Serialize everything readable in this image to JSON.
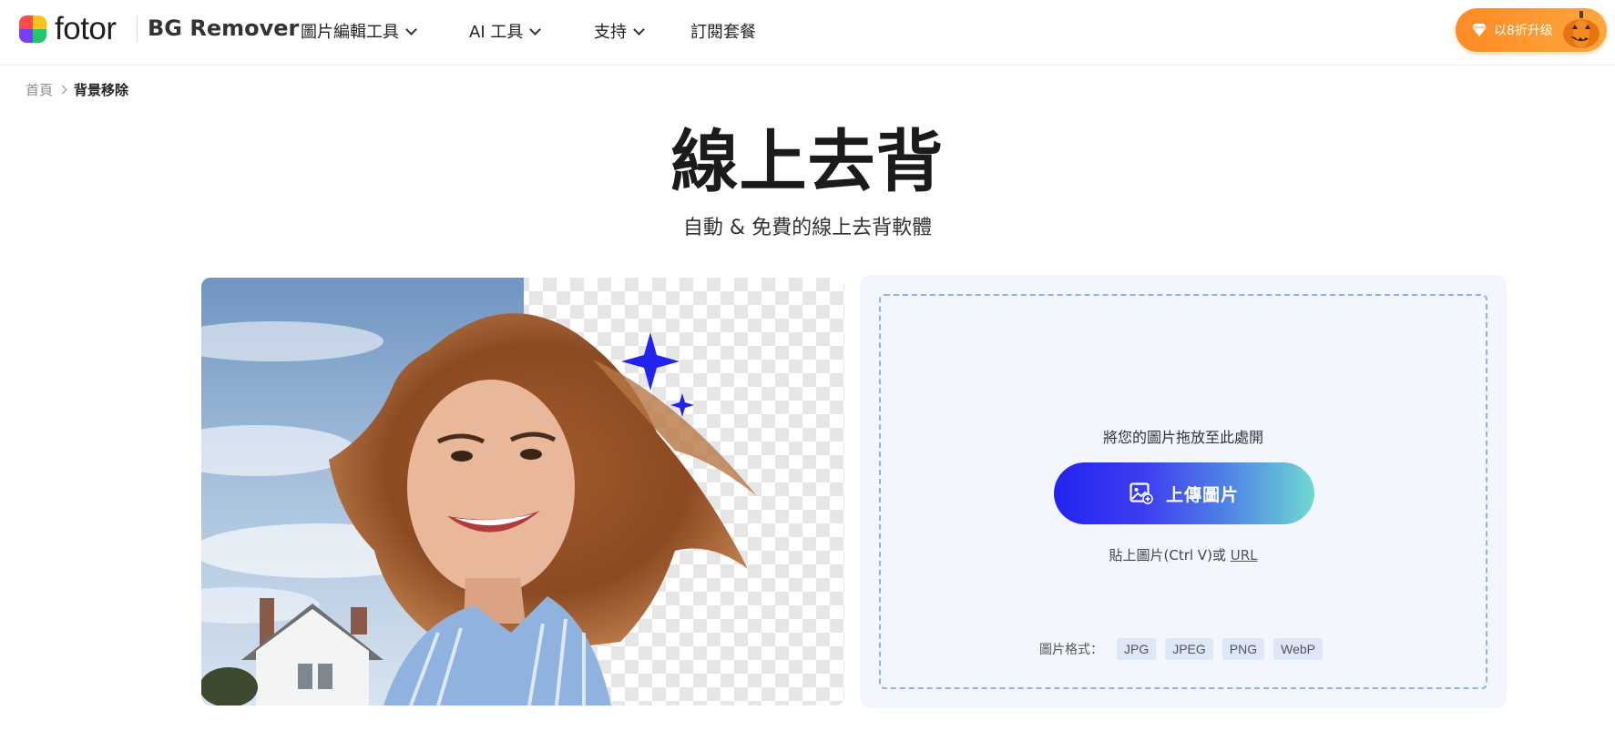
{
  "header": {
    "logo_text": "fotor",
    "product_name": "BG Remover",
    "nav": [
      {
        "label": "圖片編輯工具",
        "has_dropdown": true
      },
      {
        "label": "AI 工具",
        "has_dropdown": true
      },
      {
        "label": "支持",
        "has_dropdown": true
      },
      {
        "label": "訂閱套餐",
        "has_dropdown": false
      }
    ],
    "upgrade_label": "以8折升级"
  },
  "breadcrumb": {
    "home": "首頁",
    "current": "背景移除"
  },
  "hero": {
    "title": "線上去背",
    "subtitle": "自動 & 免費的線上去背軟體"
  },
  "upload": {
    "drop_hint": "將您的圖片拖放至此處開",
    "button_label": "上傳圖片",
    "paste_prefix": "貼上圖片(Ctrl V)或",
    "paste_link": "URL",
    "formats_label": "圖片格式：",
    "formats": [
      "JPG",
      "JPEG",
      "PNG",
      "WebP"
    ]
  },
  "colors": {
    "accent": "#2323f0",
    "upgrade": "#ff8a24",
    "panel_bg": "#f3f6fc",
    "dropzone_border": "#8fb3e6"
  },
  "icons": [
    "fotor-logo-icon",
    "chevron-down-icon",
    "diamond-icon",
    "pumpkin-icon",
    "chevron-right-icon",
    "image-add-icon",
    "sparkle-icon"
  ]
}
